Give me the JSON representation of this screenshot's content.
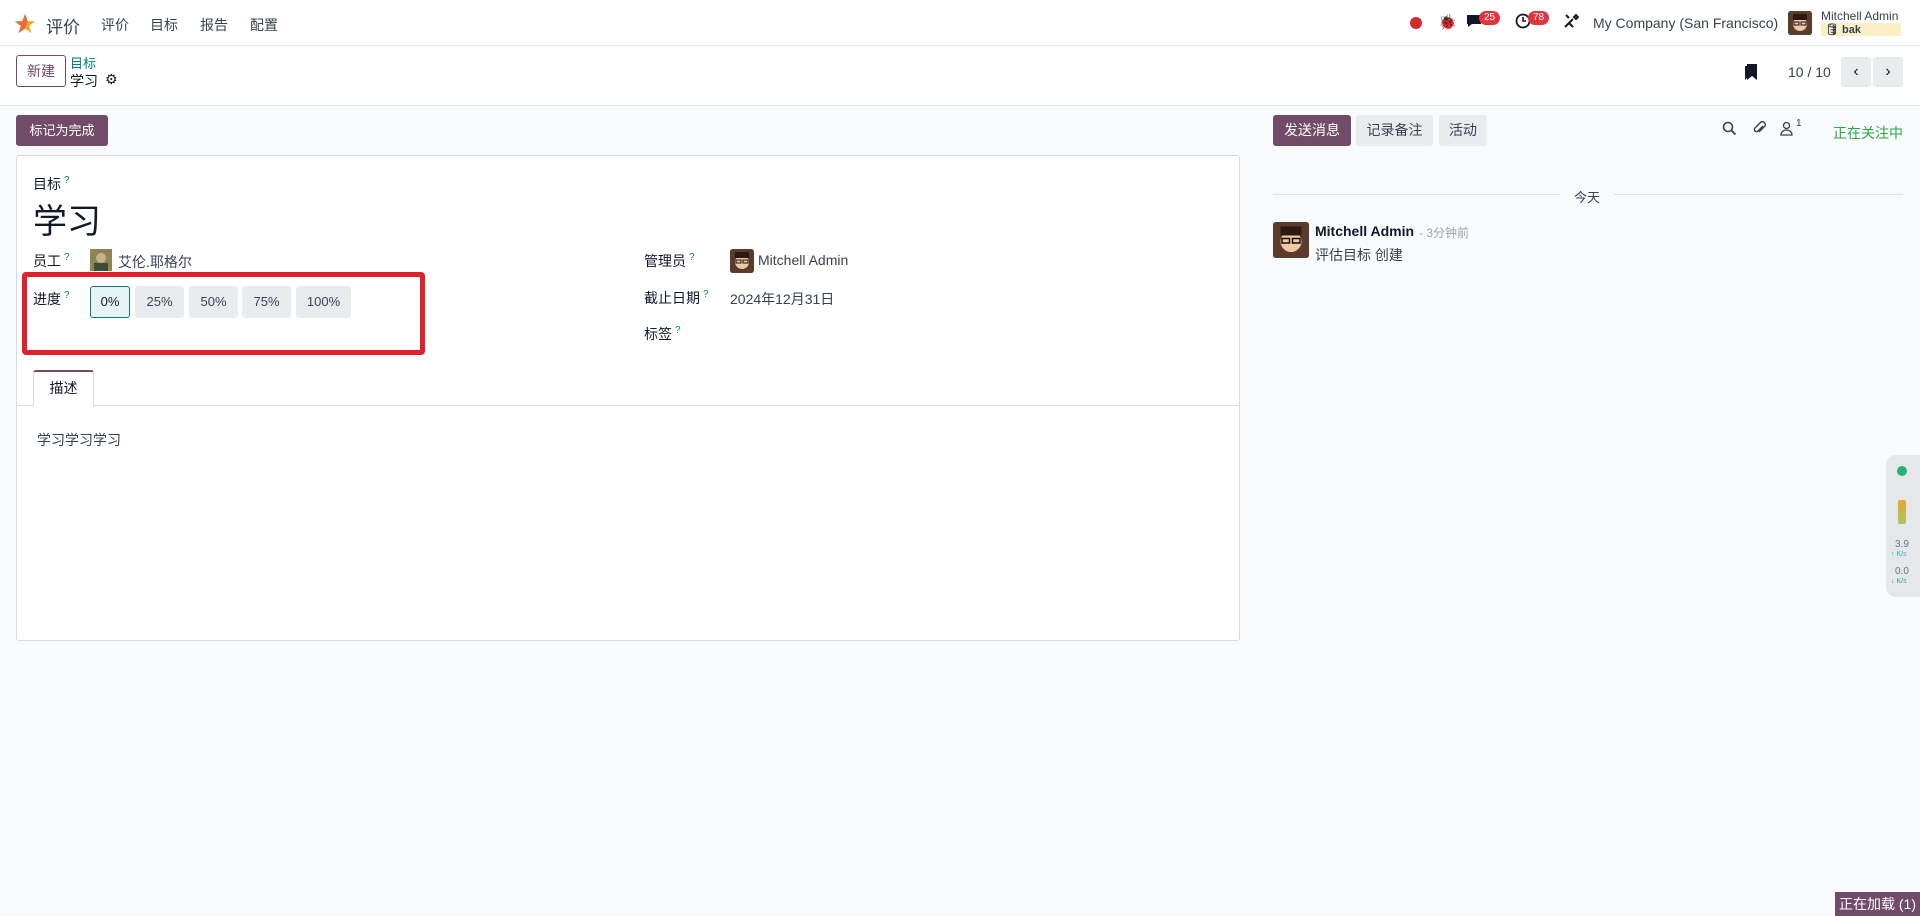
{
  "navbar": {
    "app_title": "评价",
    "menu": [
      "评价",
      "目标",
      "报告",
      "配置"
    ],
    "messages_count": "25",
    "activities_count": "78",
    "company": "My Company (San Francisco)",
    "user_name": "Mitchell Admin",
    "db_name": "bak"
  },
  "control_panel": {
    "new_button": "新建",
    "breadcrumb_parent": "目标",
    "breadcrumb_current": "学习",
    "pager": "10 / 10"
  },
  "actions": {
    "mark_done": "标记为完成"
  },
  "form": {
    "goal_label": "目标",
    "goal_title": "学习",
    "employee_label": "员工",
    "employee_value": "艾伦.耶格尔",
    "progress_label": "进度",
    "progress_options": [
      "0%",
      "25%",
      "50%",
      "75%",
      "100%"
    ],
    "progress_selected": "0%",
    "manager_label": "管理员",
    "manager_value": "Mitchell Admin",
    "deadline_label": "截止日期",
    "deadline_value": "2024年12月31日",
    "tags_label": "标签",
    "help_mark": "?",
    "tab_description": "描述",
    "description": "学习学习学习"
  },
  "chatter": {
    "send_message": "发送消息",
    "log_note": "记录备注",
    "activities": "活动",
    "followers_count": "1",
    "following": "正在关注中",
    "date_separator": "今天",
    "message": {
      "author": "Mitchell Admin",
      "time": "- 3分钟前",
      "body": "评估目标 创建"
    }
  },
  "side_widget": {
    "up_speed": "3.9",
    "down_speed": "0.0",
    "unit": "K/s"
  },
  "status_bar": {
    "loading": "正在加载 (1)"
  },
  "colors": {
    "brand": "#714b67",
    "accent": "#017e84",
    "highlight": "#e0202c",
    "following": "#28a745"
  }
}
